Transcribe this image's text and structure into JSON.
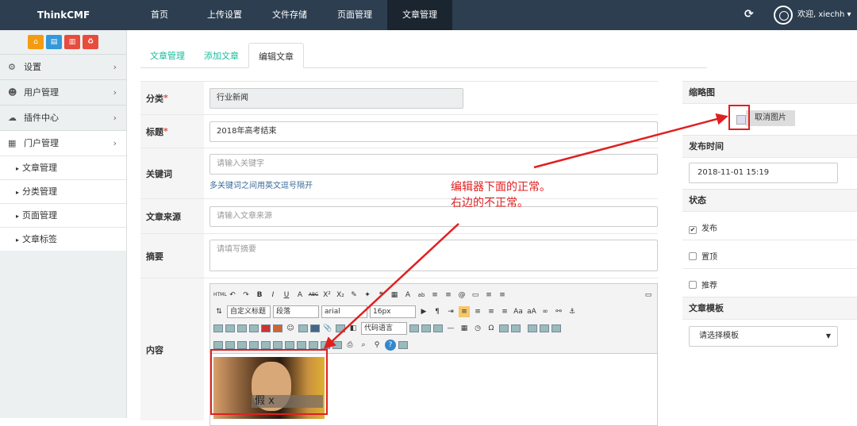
{
  "app": {
    "brand": "ThinkCMF"
  },
  "topnav": {
    "items": [
      "首页",
      "上传设置",
      "文件存储",
      "页面管理",
      "文章管理"
    ],
    "active_index": 4
  },
  "user": {
    "welcome": "欢迎, xiechh ▾"
  },
  "colors": {
    "topbar": "#2c3e50",
    "accent": "#18bc9c",
    "annotation": "#e02020",
    "quick_buttons": [
      "#f39c12",
      "#3498db",
      "#e74c3c",
      "#e74c3c"
    ]
  },
  "sidebar": {
    "quick_icons": [
      "home-icon",
      "file-icon",
      "trash-icon",
      "recycle-icon"
    ],
    "menu": [
      {
        "label": "设置",
        "icon": "gears-icon"
      },
      {
        "label": "用户管理",
        "icon": "users-icon"
      },
      {
        "label": "插件中心",
        "icon": "cloud-icon"
      },
      {
        "label": "门户管理",
        "icon": "grid-icon"
      }
    ],
    "submenu": [
      "文章管理",
      "分类管理",
      "页面管理",
      "文章标签"
    ]
  },
  "tabs": [
    "文章管理",
    "添加文章",
    "编辑文章"
  ],
  "form": {
    "category": {
      "label": "分类",
      "value": "行业新闻"
    },
    "title": {
      "label": "标题",
      "value": "2018年高考结束"
    },
    "keywords": {
      "label": "关键词",
      "placeholder": "请输入关键字",
      "help": "多关键词之间用英文逗号隔开"
    },
    "source": {
      "label": "文章来源",
      "placeholder": "请输入文章来源"
    },
    "summary": {
      "label": "摘要",
      "placeholder": "请填写摘要"
    },
    "content": {
      "label": "内容"
    }
  },
  "editor": {
    "row1": [
      "HTML",
      "↶",
      "↷",
      "B",
      "I",
      "U",
      "A",
      "ABC",
      "X²",
      "X₂",
      "✎",
      "✦",
      "❝",
      "▦",
      "A",
      "ab",
      "≡",
      "≡",
      "@",
      "▭",
      "≡",
      "≡",
      "▭"
    ],
    "paragraph_style": "自定义标题",
    "paragraph": "段落",
    "font": "arial",
    "size": "16px",
    "code_language": "代码语言"
  },
  "image_caption": "假   x",
  "right": {
    "thumbnail": {
      "label": "缩略图",
      "cancel_button": "取消图片"
    },
    "publish_time": {
      "label": "发布时间",
      "value": "2018-11-01 15:19"
    },
    "status": {
      "label": "状态",
      "options": [
        {
          "label": "发布",
          "checked": true
        },
        {
          "label": "置顶",
          "checked": false
        },
        {
          "label": "推荐",
          "checked": false
        }
      ]
    },
    "template": {
      "label": "文章模板",
      "value": "请选择模板"
    }
  },
  "annotation": {
    "line1": "编辑器下面的正常。",
    "line2": "右边的不正常。"
  }
}
